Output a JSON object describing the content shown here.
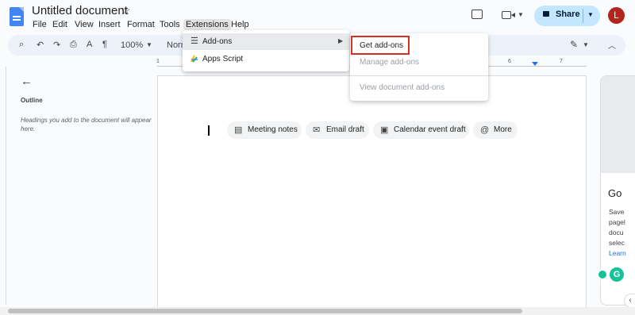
{
  "doc_title": "Untitled document",
  "menu": [
    "File",
    "Edit",
    "View",
    "Insert",
    "Format",
    "Tools",
    "Extensions",
    "Help"
  ],
  "share": {
    "label": "Share"
  },
  "avatar_letter": "L",
  "toolbar": {
    "zoom": "100%",
    "style": "Norm"
  },
  "ruler": {
    "n1": "1",
    "n6": "6",
    "n7": "7"
  },
  "outline": {
    "title": "Outline",
    "hint": "Headings you add to the document will appear here."
  },
  "chips": [
    {
      "label": "Meeting notes",
      "icon": "doc-icon"
    },
    {
      "label": "Email draft",
      "icon": "email-icon"
    },
    {
      "label": "Calendar event draft",
      "icon": "calendar-icon"
    },
    {
      "label": "More",
      "icon": "at-icon"
    }
  ],
  "extensions_menu": {
    "addons": "Add-ons",
    "apps_script": "Apps Script"
  },
  "addons_submenu": {
    "get": "Get add-ons",
    "manage": "Manage add-ons",
    "view": "View document add-ons"
  },
  "side_panel": {
    "title": "Go",
    "lines": [
      "Save",
      "pagel",
      "docu",
      "selec",
      "Learn"
    ]
  },
  "colors": {
    "accent": "#1a73e8",
    "share_bg": "#c2e7ff",
    "highlight": "#d93025",
    "avatar": "#b3261e"
  }
}
